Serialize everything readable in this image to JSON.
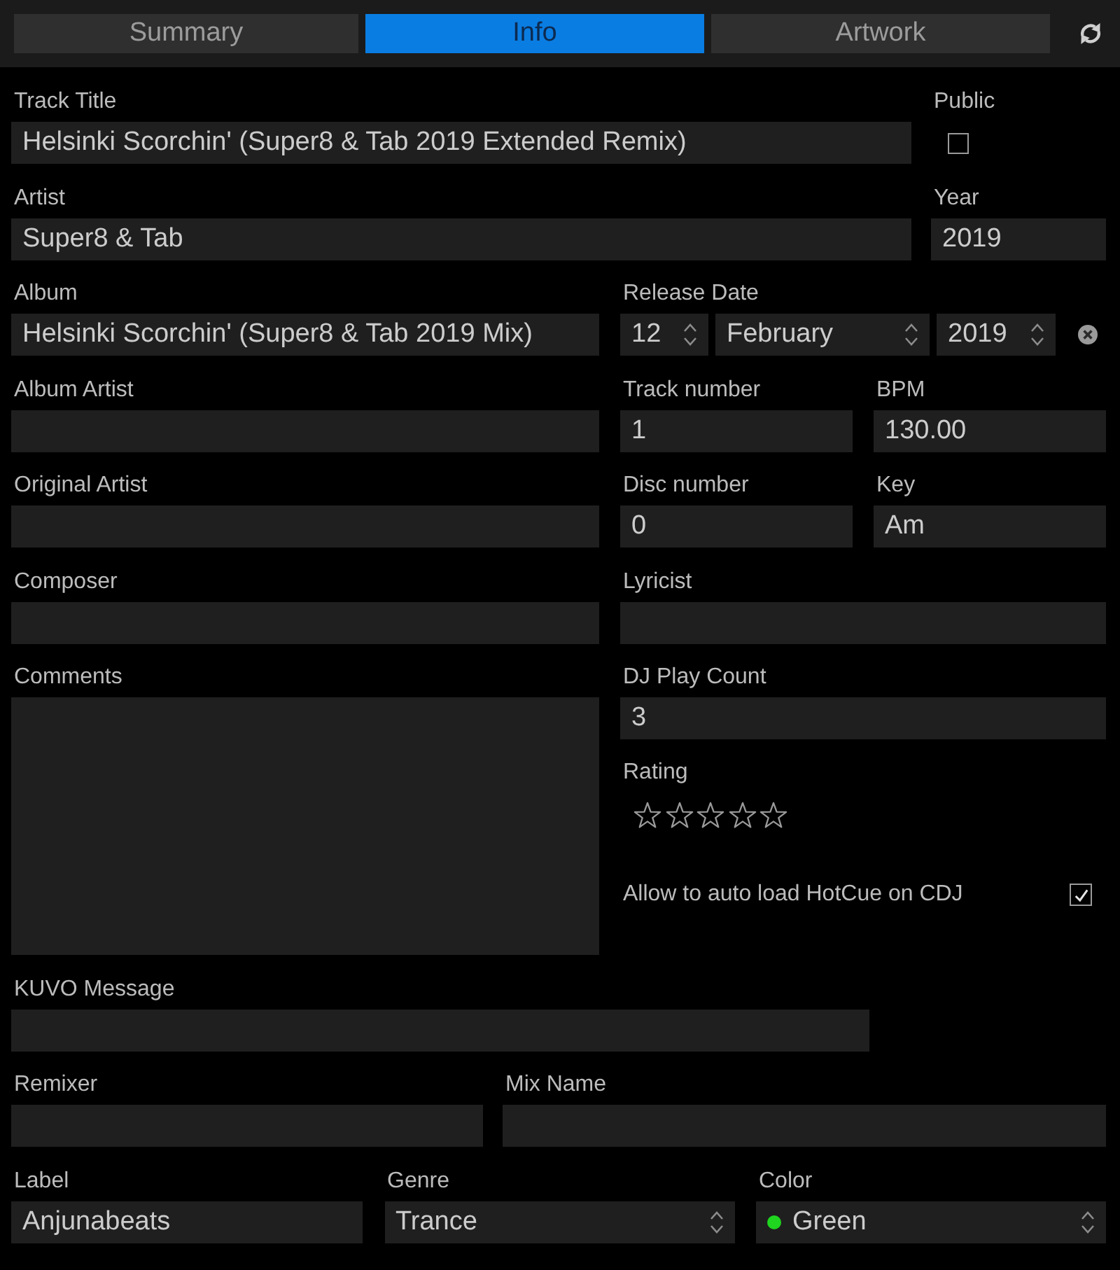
{
  "tabs": [
    {
      "label": "Summary",
      "selected": false
    },
    {
      "label": "Info",
      "selected": true
    },
    {
      "label": "Artwork",
      "selected": false
    }
  ],
  "track_title": {
    "label": "Track Title",
    "value": "Helsinki Scorchin' (Super8 & Tab 2019 Extended Remix)"
  },
  "public": {
    "label": "Public",
    "checked": false
  },
  "artist": {
    "label": "Artist",
    "value": "Super8 & Tab"
  },
  "year": {
    "label": "Year",
    "value": "2019"
  },
  "album": {
    "label": "Album",
    "value": "Helsinki Scorchin' (Super8 & Tab 2019 Mix)"
  },
  "release_date": {
    "label": "Release Date",
    "day": "12",
    "month": "February",
    "year": "2019"
  },
  "album_artist": {
    "label": "Album Artist"
  },
  "track_number": {
    "label": "Track number",
    "value": "1"
  },
  "bpm": {
    "label": "BPM",
    "value": "130.00"
  },
  "original_artist": {
    "label": "Original Artist"
  },
  "disc_number": {
    "label": "Disc number",
    "value": "0"
  },
  "key": {
    "label": "Key",
    "value": "Am"
  },
  "composer": {
    "label": "Composer"
  },
  "lyricist": {
    "label": "Lyricist"
  },
  "comments": {
    "label": "Comments"
  },
  "dj_play_count": {
    "label": "DJ Play Count",
    "value": "3"
  },
  "rating": {
    "label": "Rating",
    "stars": 0
  },
  "auto_load_hotcue": {
    "label": "Allow to auto load HotCue on CDJ",
    "checked": true
  },
  "kuvo_message": {
    "label": "KUVO Message"
  },
  "remixer": {
    "label": "Remixer"
  },
  "mix_name": {
    "label": "Mix Name"
  },
  "label": {
    "label": "Label",
    "value": "Anjunabeats"
  },
  "genre": {
    "label": "Genre",
    "value": "Trance"
  },
  "color": {
    "label": "Color",
    "value": "Green"
  }
}
